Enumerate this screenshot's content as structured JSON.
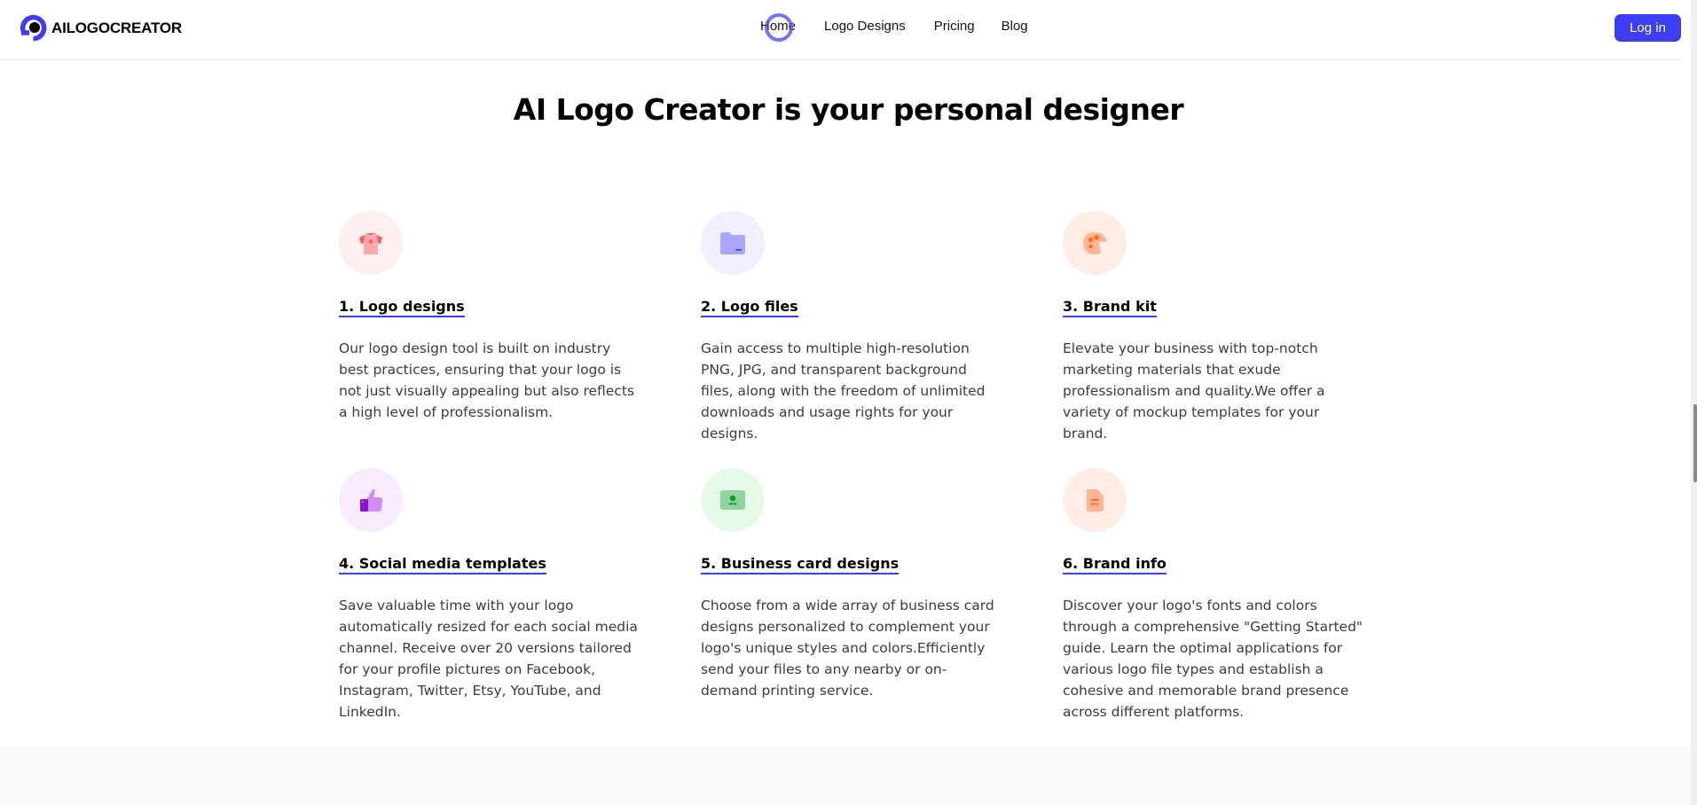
{
  "navbar": {
    "brand": {
      "name": "AILOGOCREATOR",
      "icon": "brand-logo-icon",
      "accent": "#3d3df5"
    },
    "links": [
      {
        "label": "Home"
      },
      {
        "label": "Logo Designs"
      },
      {
        "label": "Pricing"
      },
      {
        "label": "Blog"
      }
    ],
    "login_label": "Log in"
  },
  "section": {
    "title": "AI Logo Creator is your personal designer",
    "features": [
      {
        "title": "1. Logo designs",
        "icon": "t-shirt-icon",
        "circle_color": "#fdeef0",
        "description": "Our logo design tool is built on industry best practices, ensuring that your logo is not just visually appealing but also reflects a high level of professionalism."
      },
      {
        "title": "2. Logo files",
        "icon": "folder-icon",
        "circle_color": "#f0efff",
        "description": "Gain access to multiple high-resolution PNG, JPG, and transparent background files, along with the freedom of unlimited downloads and usage rights for your designs."
      },
      {
        "title": "3. Brand kit",
        "icon": "palette-icon",
        "circle_color": "#ffede4",
        "description": "Elevate your business with top-notch marketing materials that exude professionalism and quality.We offer a variety of mockup templates for your brand."
      },
      {
        "title": "4. Social media templates",
        "icon": "thumbs-up-icon",
        "circle_color": "#f8ebff",
        "description": "Save valuable time with your logo automatically resized for each social media channel. Receive over 20 versions tailored for your profile pictures on Facebook, Instagram, Twitter, Etsy, YouTube, and LinkedIn."
      },
      {
        "title": "5. Business card designs",
        "icon": "id-card-icon",
        "circle_color": "#e5fbe7",
        "description": "Choose from a wide array of business card designs personalized to complement your logo's unique styles and colors.Efficiently send your files to any nearby or on-demand printing service."
      },
      {
        "title": "6. Brand info",
        "icon": "document-icon",
        "circle_color": "#ffede4",
        "description": "Discover your logo's fonts and colors through a comprehensive \"Getting Started\" guide. Learn the optimal applications for various logo file types and establish a cohesive and memorable brand presence across different platforms."
      }
    ]
  }
}
